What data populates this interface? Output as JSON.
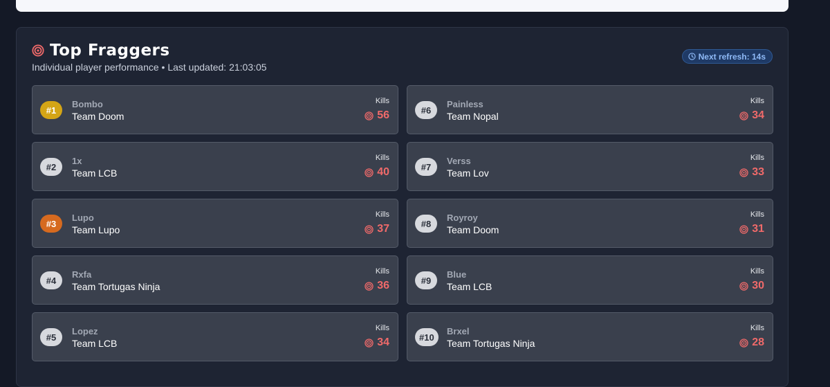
{
  "section": {
    "title": "Top Fraggers",
    "subtitle": "Individual player performance • Last updated: 21:03:05",
    "refresh_label": "Next refresh: 14s",
    "kills_label": "Kills"
  },
  "colors": {
    "accent_red": "#f06a6a",
    "gold": "#d4a516",
    "bronze": "#d66a1f",
    "badge_blue": "#8fbaf7"
  },
  "icons": {
    "title": "target-icon",
    "refresh": "clock-icon",
    "kills": "target-icon"
  },
  "players": [
    {
      "rank": "#1",
      "name": "Bombo",
      "team": "Team Doom",
      "kills": "56"
    },
    {
      "rank": "#2",
      "name": "1x",
      "team": "Team LCB",
      "kills": "40"
    },
    {
      "rank": "#3",
      "name": "Lupo",
      "team": "Team Lupo",
      "kills": "37"
    },
    {
      "rank": "#4",
      "name": "Rxfa",
      "team": "Team Tortugas Ninja",
      "kills": "36"
    },
    {
      "rank": "#5",
      "name": "Lopez",
      "team": "Team LCB",
      "kills": "34"
    },
    {
      "rank": "#6",
      "name": "Painless",
      "team": "Team Nopal",
      "kills": "34"
    },
    {
      "rank": "#7",
      "name": "Verss",
      "team": "Team Lov",
      "kills": "33"
    },
    {
      "rank": "#8",
      "name": "Royroy",
      "team": "Team Doom",
      "kills": "31"
    },
    {
      "rank": "#9",
      "name": "Blue",
      "team": "Team LCB",
      "kills": "30"
    },
    {
      "rank": "#10",
      "name": "Brxel",
      "team": "Team Tortugas Ninja",
      "kills": "28"
    }
  ]
}
